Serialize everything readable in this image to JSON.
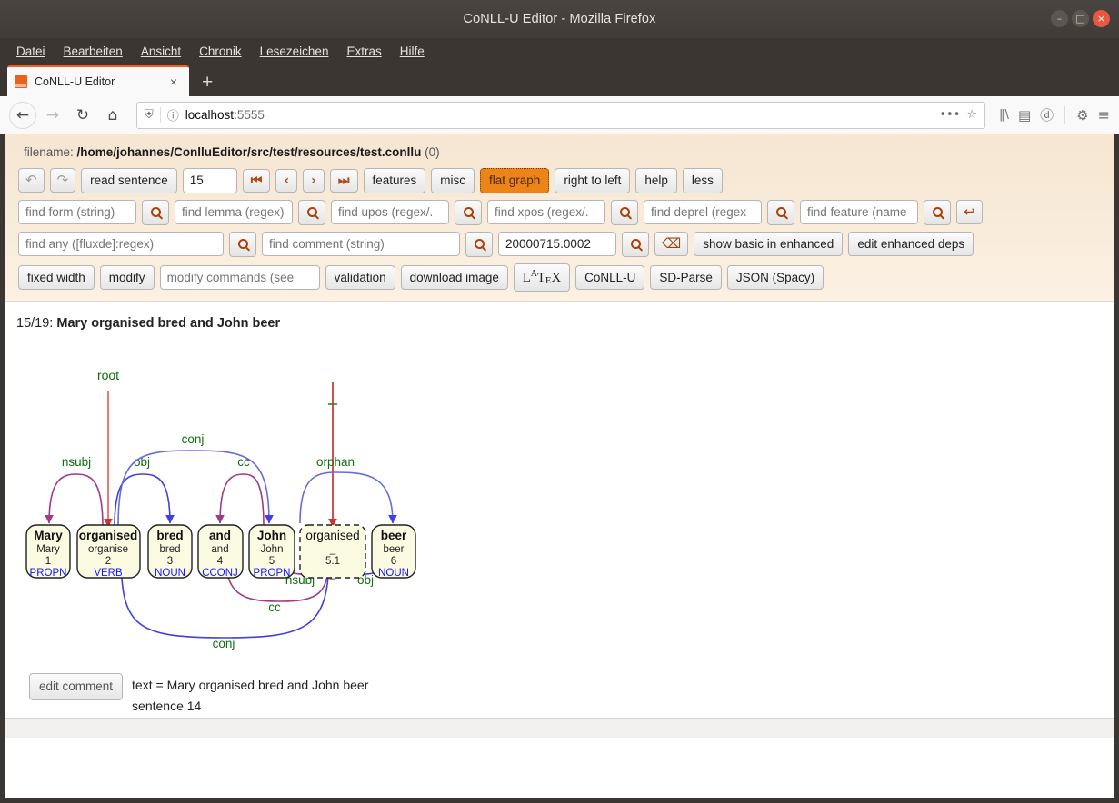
{
  "window": {
    "title": "CoNLL-U Editor - Mozilla Firefox",
    "minimize": "–",
    "maximize": "□",
    "close": "×"
  },
  "menubar": {
    "items": [
      {
        "label": "Datei",
        "accel": "D"
      },
      {
        "label": "Bearbeiten",
        "accel": "B"
      },
      {
        "label": "Ansicht",
        "accel": "A"
      },
      {
        "label": "Chronik",
        "accel": "C"
      },
      {
        "label": "Lesezeichen",
        "accel": "L"
      },
      {
        "label": "Extras",
        "accel": "x"
      },
      {
        "label": "Hilfe",
        "accel": "H"
      }
    ]
  },
  "tabbar": {
    "tab_title": "CoNLL-U Editor",
    "tab_close": "×",
    "new_tab": "+"
  },
  "navbar": {
    "back": "←",
    "forward": "→",
    "reload": "↻",
    "home": "⌂",
    "shield_icon": "⛨",
    "info_icon": "ⓘ",
    "url_host": "localhost",
    "url_port": ":5555",
    "page_actions": "•••",
    "bookmark_star": "☆",
    "library_icon": "‖\\",
    "sidebar_icon": "▤",
    "account_icon": "ⓓ",
    "extension_icon": "⚙",
    "menu_icon": "≡"
  },
  "file": {
    "label": "filename:",
    "path": "/home/johannes/ConlluEditor/src/test/resources/test.conllu",
    "count": "(0)"
  },
  "toolbar1": {
    "undo": "↶",
    "redo": "↷",
    "read_sentence": "read sentence",
    "sentence_number": "15",
    "first": "⏮",
    "prev": "‹",
    "next": "›",
    "last": "⏭",
    "features": "features",
    "misc": "misc",
    "flat_graph": "flat graph",
    "right_to_left": "right to left",
    "help": "help",
    "less": "less"
  },
  "toolbar2": {
    "find_form_placeholder": "find form (string)",
    "find_lemma_placeholder": "find lemma (regex)",
    "find_upos_placeholder": "find upos (regex/.",
    "find_xpos_placeholder": "find xpos (regex/.",
    "find_deprel_placeholder": "find deprel (regex",
    "find_feature_placeholder": "find feature (name",
    "search_icon": "search-icon",
    "enter_icon": "↩"
  },
  "toolbar3": {
    "find_any_placeholder": "find any ([fluxde]:regex)",
    "find_comment_placeholder": "find comment (string)",
    "sentence_id_value": "20000715.0002",
    "clear_icon": "⌫",
    "show_basic_in_enhanced": "show basic in enhanced",
    "edit_enhanced_deps": "edit enhanced deps"
  },
  "toolbar4": {
    "fixed_width": "fixed width",
    "modify": "modify",
    "modify_commands_placeholder": "modify commands (see",
    "validation": "validation",
    "download_image": "download image",
    "latex": "LATEX",
    "conllu": "CoNLL-U",
    "sd_parse": "SD-Parse",
    "json_spacy": "JSON (Spacy)"
  },
  "sentence": {
    "index": "15/19:",
    "text": "Mary organised bred and John beer"
  },
  "graph": {
    "root_label": "root",
    "tokens": [
      {
        "form": "Mary",
        "lemma": "Mary",
        "id": "1",
        "upos": "PROPN",
        "empty": false
      },
      {
        "form": "organised",
        "lemma": "organise",
        "id": "2",
        "upos": "VERB",
        "empty": false
      },
      {
        "form": "bred",
        "lemma": "bred",
        "id": "3",
        "upos": "NOUN",
        "empty": false
      },
      {
        "form": "and",
        "lemma": "and",
        "id": "4",
        "upos": "CCONJ",
        "empty": false
      },
      {
        "form": "John",
        "lemma": "John",
        "id": "5",
        "upos": "PROPN",
        "empty": false
      },
      {
        "form": "organised",
        "lemma": "_",
        "id": "5.1",
        "upos": "_",
        "empty": true
      },
      {
        "form": "beer",
        "lemma": "beer",
        "id": "6",
        "upos": "NOUN",
        "empty": false
      }
    ],
    "arcs_above": [
      {
        "label": "nsubj",
        "from": "2",
        "to": "1",
        "color": "#a03a8a"
      },
      {
        "label": "obj",
        "from": "2",
        "to": "3",
        "color": "#4040e0"
      },
      {
        "label": "conj",
        "from": "2",
        "to": "5",
        "color": "#4040e0"
      },
      {
        "label": "cc",
        "from": "5",
        "to": "4",
        "color": "#a03a8a"
      },
      {
        "label": "orphan",
        "from": "5.1",
        "to": "6",
        "color": "#4040e0"
      }
    ],
    "arcs_below": [
      {
        "label": "cc",
        "from": "5.1",
        "to": "4",
        "color": "#a03a8a"
      },
      {
        "label": "nsubj",
        "from": "5.1",
        "to": "5",
        "color": "#a03a8a"
      },
      {
        "label": "obj",
        "from": "5.1",
        "to": "6",
        "color": "#4040e0"
      },
      {
        "label": "conj",
        "from": "2",
        "to": "5.1",
        "color": "#4040e0"
      }
    ]
  },
  "comment": {
    "edit_button": "edit comment",
    "lines": [
      "text = Mary organised bred and John beer",
      "sentence 14"
    ]
  },
  "colors": {
    "accent_orange": "#ed8418",
    "label_green": "#107010",
    "arc_blue": "#4040e0",
    "arc_purple": "#a03a8a",
    "root_red": "#e04040",
    "upos_blue": "#1414ff",
    "token_fill": "#fbfbe2"
  }
}
